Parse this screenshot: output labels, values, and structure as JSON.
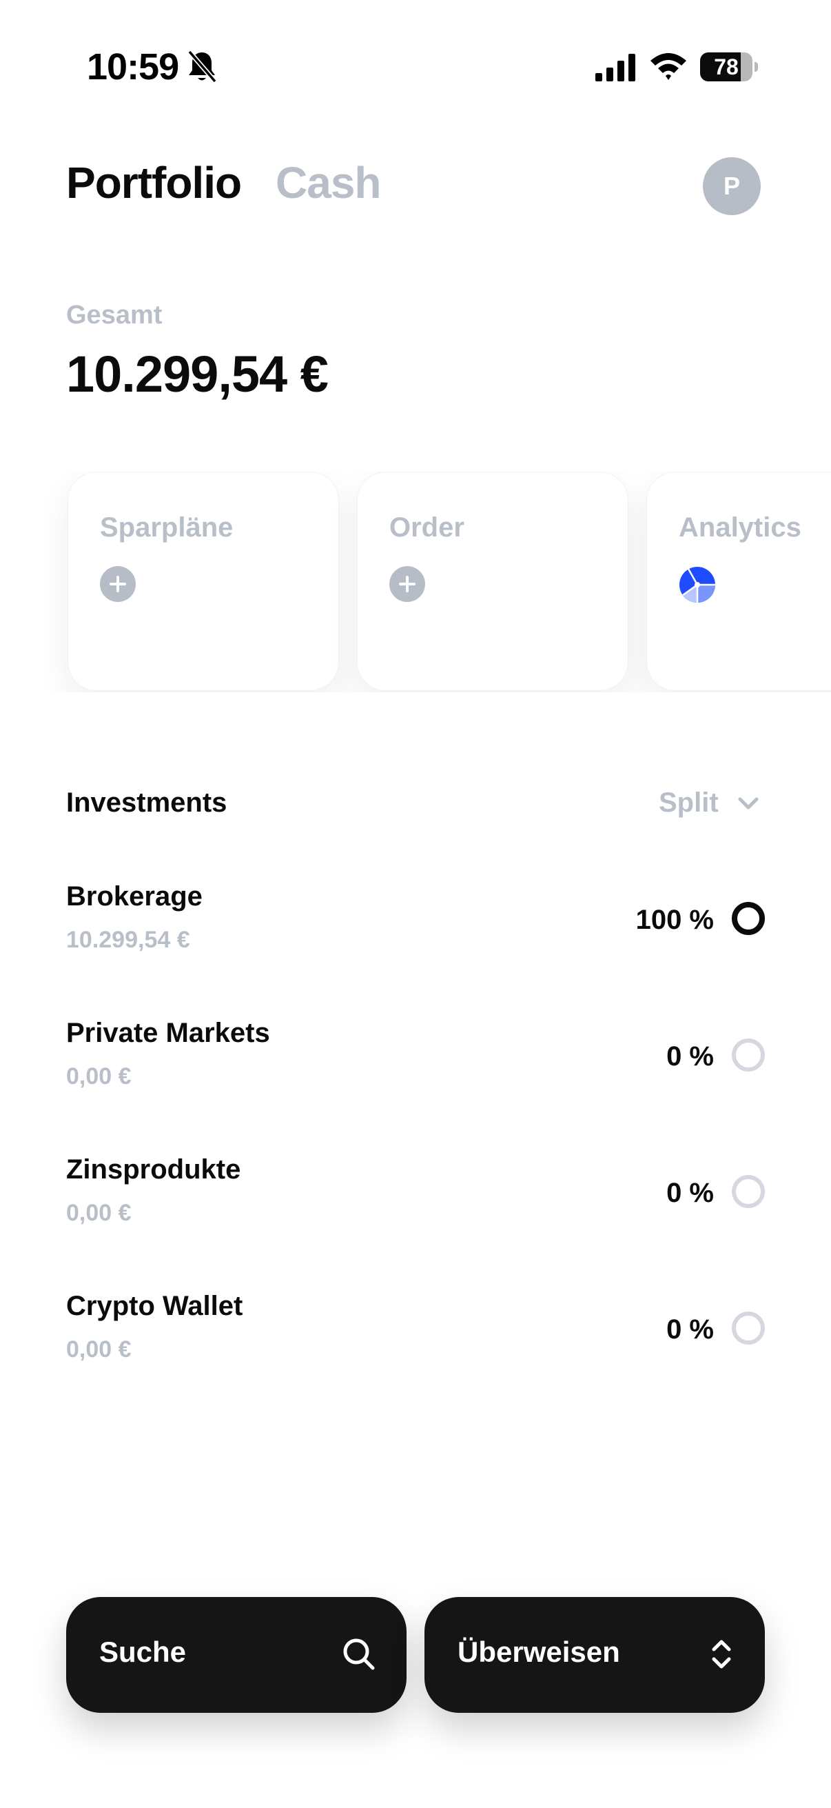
{
  "status_bar": {
    "time": "10:59",
    "battery_level": "78",
    "battery_fraction": 0.78
  },
  "header": {
    "tabs": [
      {
        "label": "Portfolio",
        "active": true
      },
      {
        "label": "Cash",
        "active": false
      }
    ],
    "avatar_initial": "P"
  },
  "total": {
    "label": "Gesamt",
    "value": "10.299,54 €"
  },
  "cards": [
    {
      "title": "Sparpläne",
      "icon": "plus-icon"
    },
    {
      "title": "Order",
      "icon": "plus-icon"
    },
    {
      "title": "Analytics",
      "icon": "pie-chart-icon"
    }
  ],
  "investments": {
    "heading": "Investments",
    "sort_label": "Split",
    "items": [
      {
        "name": "Brokerage",
        "amount": "10.299,54 €",
        "percent": "100 %",
        "share": 1.0
      },
      {
        "name": "Private Markets",
        "amount": "0,00 €",
        "percent": "0 %",
        "share": 0
      },
      {
        "name": "Zinsprodukte",
        "amount": "0,00 €",
        "percent": "0 %",
        "share": 0
      },
      {
        "name": "Crypto Wallet",
        "amount": "0,00 €",
        "percent": "0 %",
        "share": 0
      }
    ]
  },
  "bottom_bar": {
    "search_label": "Suche",
    "transfer_label": "Überweisen"
  },
  "colors": {
    "text_primary": "#0b0b0c",
    "text_muted": "#b9bfc9",
    "button_dark": "#151516",
    "analytics_blue": "#1f4cff"
  }
}
